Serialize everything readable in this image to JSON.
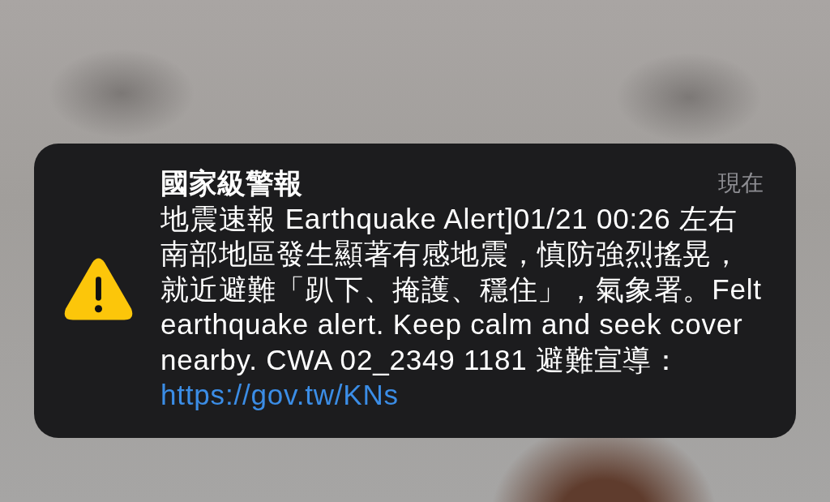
{
  "notification": {
    "title": "國家級警報",
    "time": "現在",
    "message": "地震速報 Earthquake Alert]01/21 00:26 左右南部地區發生顯著有感地震，慎防強烈搖晃，就近避難「趴下、掩護、穩住」，氣象署。Felt earthquake alert. Keep calm and seek cover nearby. CWA 02_2349 1181 避難宣導：",
    "link": "https://gov.tw/KNs"
  }
}
